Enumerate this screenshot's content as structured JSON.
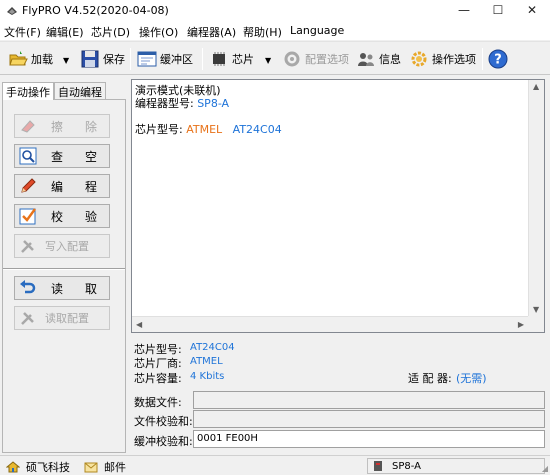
{
  "window": {
    "title": "FlyPRO V4.52(2020-04-08)",
    "minimize_glyph": "—",
    "maximize_glyph": "☐",
    "close_glyph": "✕"
  },
  "menu": [
    "文件(F)",
    "编辑(E)",
    "芯片(D)",
    "操作(O)",
    "编程器(A)",
    "帮助(H)",
    "Language"
  ],
  "toolbar": {
    "load": "加载",
    "save": "保存",
    "buffer": "缓冲区",
    "chip": "芯片",
    "config_options": "配置选项",
    "info": "信息",
    "operation_options": "操作选项",
    "dropdown_glyph": "▼",
    "help_glyph": "?"
  },
  "tabs": {
    "manual": "手动操作",
    "auto": "自动编程"
  },
  "operations": {
    "erase": "擦除",
    "blank_check": "查空",
    "program": "编程",
    "verify": "校验",
    "write_config": "写入配置",
    "read": "读取",
    "read_config": "读取配置"
  },
  "messages": {
    "demo_mode": "演示模式(未联机)",
    "programmer_label": "编程器型号: ",
    "programmer_value": "SP8-A",
    "chip_label": "芯片型号: ",
    "chip_vendor": "ATMEL",
    "chip_model": "AT24C04"
  },
  "info": {
    "chip_model_label": "芯片型号:",
    "chip_model_value": "AT24C04",
    "vendor_label": "芯片厂商:",
    "vendor_value": "ATMEL",
    "capacity_label": "芯片容量:",
    "capacity_value": "4 Kbits",
    "adapter_label": "适 配 器:",
    "adapter_value": "(无需)",
    "data_file_label": "数据文件:",
    "data_file_value": "",
    "file_checksum_label": "文件校验和:",
    "file_checksum_value": "",
    "buffer_checksum_label": "缓冲校验和:",
    "buffer_checksum_value": "0001 FE00H"
  },
  "statusbar": {
    "company": "硕飞科技",
    "mail": "邮件",
    "device": "SP8-A"
  },
  "colors": {
    "accent_blue": "#1e73d8",
    "vendor_orange": "#e8731a"
  },
  "icons": {
    "app": "flypro-icon",
    "load": "folder-open-icon",
    "save": "floppy-disk-icon",
    "buffer": "buffer-window-icon",
    "chip": "chip-icon",
    "config": "config-gear-icon",
    "info": "info-people-icon",
    "options": "gear-icon",
    "help": "help-icon",
    "erase": "eraser-icon",
    "blank_check": "magnifier-icon",
    "program": "pencil-icon",
    "verify": "checkbox-icon",
    "write_config": "tools-icon",
    "read": "undo-arrow-icon",
    "read_config": "tools-icon",
    "company": "home-icon",
    "mail": "mail-icon",
    "device": "usb-device-icon"
  }
}
